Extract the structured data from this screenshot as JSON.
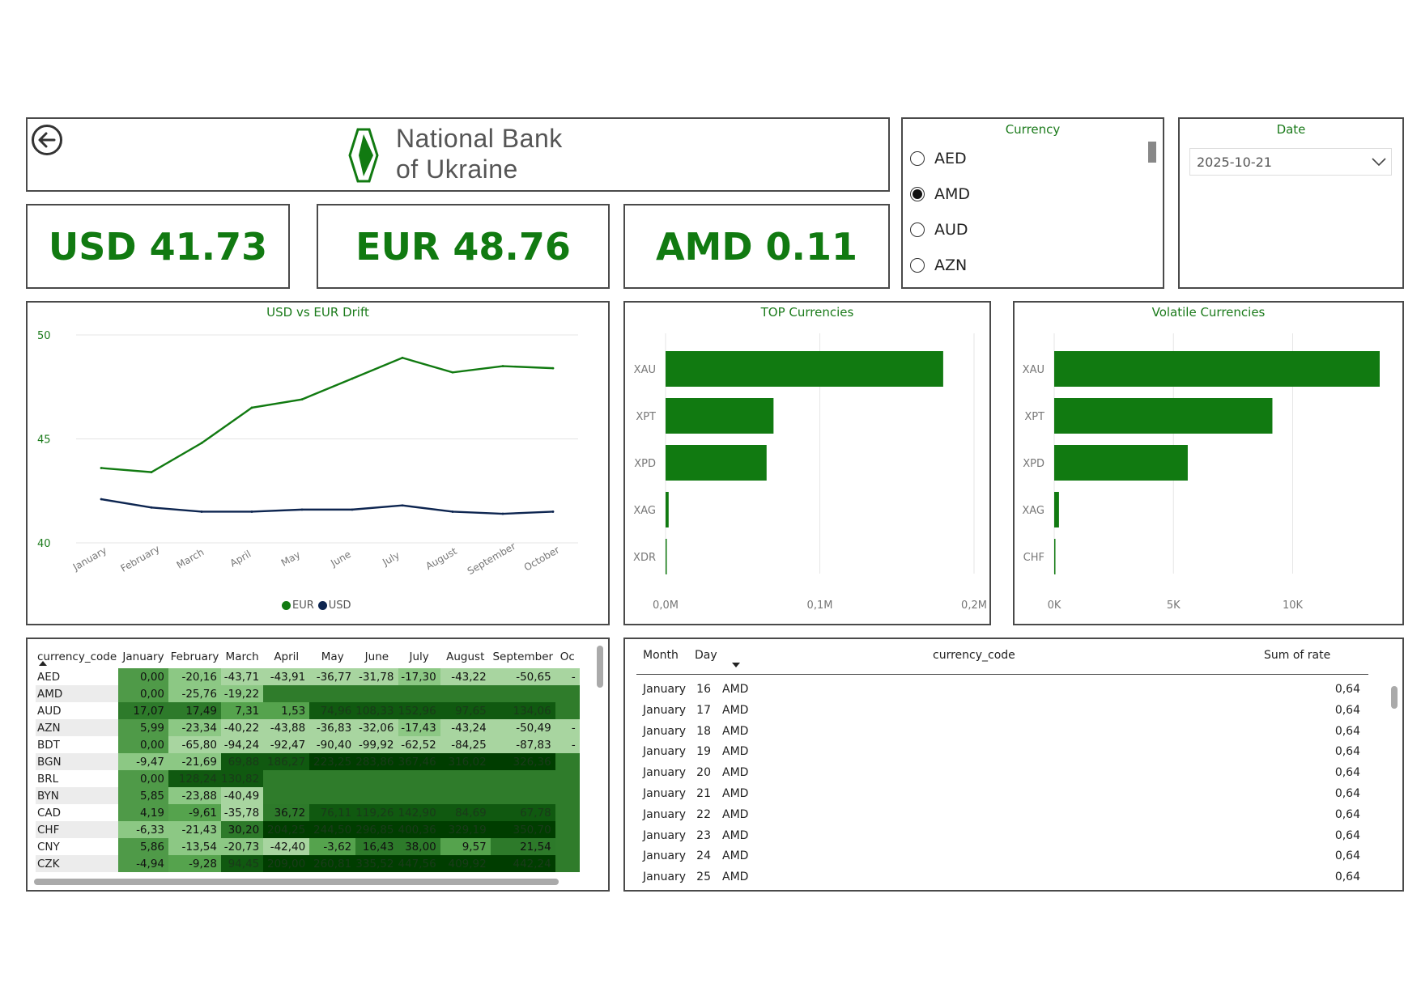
{
  "header": {
    "logo_line1": "National Bank",
    "logo_line2": "of Ukraine",
    "back_icon": "back-arrow-icon"
  },
  "kpis": [
    {
      "code": "USD",
      "value": "41.73",
      "label": "USD 41.73"
    },
    {
      "code": "EUR",
      "value": "48.76",
      "label": "EUR 48.76"
    },
    {
      "code": "AMD",
      "value": "0.11",
      "label": "AMD 0.11"
    }
  ],
  "currency_slicer": {
    "title": "Currency",
    "options": [
      "AED",
      "AMD",
      "AUD",
      "AZN"
    ],
    "selected": "AMD"
  },
  "date_slicer": {
    "title": "Date",
    "value": "2025-10-21"
  },
  "colors": {
    "eur": "#117a11",
    "usd": "#0d2550",
    "bar": "#117a11",
    "title": "#1a7a1a"
  },
  "charts": {
    "line": {
      "title": "USD vs EUR Drift",
      "legend": [
        "EUR",
        "USD"
      ]
    },
    "top": {
      "title": "TOP Currencies"
    },
    "volatile": {
      "title": "Volatile Currencies"
    }
  },
  "chart_data": [
    {
      "type": "line",
      "title": "USD vs EUR Drift",
      "categories": [
        "January",
        "February",
        "March",
        "April",
        "May",
        "June",
        "July",
        "August",
        "September",
        "October"
      ],
      "series": [
        {
          "name": "EUR",
          "values": [
            43.6,
            43.4,
            44.8,
            46.5,
            46.9,
            47.9,
            48.9,
            48.2,
            48.5,
            48.4
          ]
        },
        {
          "name": "USD",
          "values": [
            42.1,
            41.7,
            41.5,
            41.5,
            41.6,
            41.6,
            41.8,
            41.5,
            41.4,
            41.5
          ]
        }
      ],
      "yticks": [
        40,
        45,
        50
      ],
      "ylim": [
        40,
        50
      ],
      "legend_position": "bottom"
    },
    {
      "type": "bar",
      "orientation": "horizontal",
      "title": "TOP Currencies",
      "categories": [
        "XAU",
        "XPT",
        "XPD",
        "XAG",
        "XDR"
      ],
      "values": [
        180000,
        70000,
        65500,
        2000,
        500
      ],
      "xticks": [
        "0,0M",
        "0,1M",
        "0,2M"
      ],
      "xtick_values": [
        0,
        100000,
        200000
      ],
      "xlim": [
        0,
        200000
      ]
    },
    {
      "type": "bar",
      "orientation": "horizontal",
      "title": "Volatile Currencies",
      "categories": [
        "XAU",
        "XPT",
        "XPD",
        "XAG",
        "CHF"
      ],
      "values": [
        13650,
        9150,
        5600,
        200,
        40
      ],
      "xticks": [
        "0K",
        "5K",
        "10K"
      ],
      "xtick_values": [
        0,
        5000,
        10000
      ],
      "xlim": [
        0,
        13650
      ]
    }
  ],
  "matrix": {
    "headers": [
      "currency_code",
      "January",
      "February",
      "March",
      "April",
      "May",
      "June",
      "July",
      "August",
      "September",
      "Oc"
    ],
    "rows": [
      {
        "code": "AED",
        "vals": [
          "0,00",
          "-20,16",
          "-43,71",
          "-43,91",
          "-36,77",
          "-31,78",
          "-17,30",
          "-43,22",
          "-50,65",
          "-"
        ]
      },
      {
        "code": "AMD",
        "vals": [
          "0,00",
          "-25,76",
          "-19,22",
          "",
          "",
          "",
          "",
          "",
          "",
          ""
        ]
      },
      {
        "code": "AUD",
        "vals": [
          "17,07",
          "17,49",
          "7,31",
          "1,53",
          "74,96",
          "108,33",
          "152,96",
          "97,65",
          "134,06",
          ""
        ]
      },
      {
        "code": "AZN",
        "vals": [
          "5,99",
          "-23,34",
          "-40,22",
          "-43,88",
          "-36,83",
          "-32,06",
          "-17,43",
          "-43,24",
          "-50,49",
          "-"
        ]
      },
      {
        "code": "BDT",
        "vals": [
          "0,00",
          "-65,80",
          "-94,24",
          "-92,47",
          "-90,40",
          "-99,92",
          "-62,52",
          "-84,25",
          "-87,83",
          "-"
        ]
      },
      {
        "code": "BGN",
        "vals": [
          "-9,47",
          "-21,69",
          "69,88",
          "186,27",
          "223,25",
          "283,86",
          "367,46",
          "316,02",
          "326,36",
          ""
        ]
      },
      {
        "code": "BRL",
        "vals": [
          "0,00",
          "128,24",
          "130,82",
          "",
          "",
          "",
          "",
          "",
          "",
          ""
        ]
      },
      {
        "code": "BYN",
        "vals": [
          "5,85",
          "-23,88",
          "-40,49",
          "",
          "",
          "",
          "",
          "",
          "",
          ""
        ]
      },
      {
        "code": "CAD",
        "vals": [
          "4,19",
          "-9,61",
          "-35,78",
          "36,72",
          "76,11",
          "119,26",
          "142,90",
          "84,69",
          "67,78",
          ""
        ]
      },
      {
        "code": "CHF",
        "vals": [
          "-6,33",
          "-21,43",
          "30,20",
          "204,25",
          "244,50",
          "296,85",
          "400,36",
          "329,19",
          "350,70",
          ""
        ]
      },
      {
        "code": "CNY",
        "vals": [
          "5,86",
          "-13,54",
          "-20,73",
          "-42,40",
          "-3,62",
          "16,43",
          "38,00",
          "9,57",
          "21,54",
          ""
        ]
      },
      {
        "code": "CZK",
        "vals": [
          "-4,94",
          "-9,28",
          "94,45",
          "209,00",
          "260,81",
          "335,52",
          "447,56",
          "409,92",
          "442,24",
          ""
        ]
      }
    ]
  },
  "detail_table": {
    "headers": {
      "month": "Month",
      "day": "Day",
      "code": "currency_code",
      "rate": "Sum of rate"
    },
    "rows": [
      {
        "month": "January",
        "day": "16",
        "code": "AMD",
        "rate": "0,64"
      },
      {
        "month": "January",
        "day": "17",
        "code": "AMD",
        "rate": "0,64"
      },
      {
        "month": "January",
        "day": "18",
        "code": "AMD",
        "rate": "0,64"
      },
      {
        "month": "January",
        "day": "19",
        "code": "AMD",
        "rate": "0,64"
      },
      {
        "month": "January",
        "day": "20",
        "code": "AMD",
        "rate": "0,64"
      },
      {
        "month": "January",
        "day": "21",
        "code": "AMD",
        "rate": "0,64"
      },
      {
        "month": "January",
        "day": "22",
        "code": "AMD",
        "rate": "0,64"
      },
      {
        "month": "January",
        "day": "23",
        "code": "AMD",
        "rate": "0,64"
      },
      {
        "month": "January",
        "day": "24",
        "code": "AMD",
        "rate": "0,64"
      },
      {
        "month": "January",
        "day": "25",
        "code": "AMD",
        "rate": "0,64"
      }
    ]
  }
}
